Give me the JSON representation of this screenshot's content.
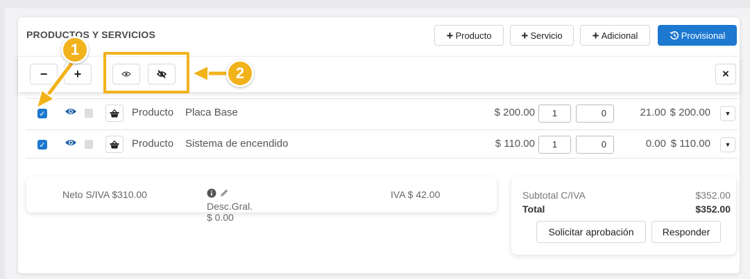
{
  "section_title": "PRODUCTOS Y SERVICIOS",
  "header_buttons": {
    "producto": "Producto",
    "servicio": "Servicio",
    "adicional": "Adicional",
    "provisional": "Provisional"
  },
  "toolbar": {
    "collapse": "−",
    "expand": "+",
    "close": "×"
  },
  "rows": [
    {
      "type": "Producto",
      "name": "Placa Base",
      "price": "$ 200.00",
      "qty": "1",
      "discount": "0",
      "tax": "21.00",
      "total": "$ 200.00",
      "checked": true
    },
    {
      "type": "Producto",
      "name": "Sistema de encendido",
      "price": "$ 110.00",
      "qty": "1",
      "discount": "0",
      "tax": "0.00",
      "total": "$ 110.00",
      "checked": true
    }
  ],
  "summary": {
    "neto": "Neto S/IVA $310.00",
    "desc": "Desc.Gral. $ 0.00",
    "iva": "IVA $ 42.00"
  },
  "totals": {
    "subtotal_label": "Subtotal C/IVA",
    "subtotal_value": "$352.00",
    "total_label": "Total",
    "total_value": "$352.00",
    "approve_button": "Solicitar aprobación",
    "respond_button": "Responder"
  },
  "callouts": [
    "1",
    "2"
  ],
  "colors": {
    "accent": "#1d78d0",
    "callout": "#f2b21b"
  }
}
